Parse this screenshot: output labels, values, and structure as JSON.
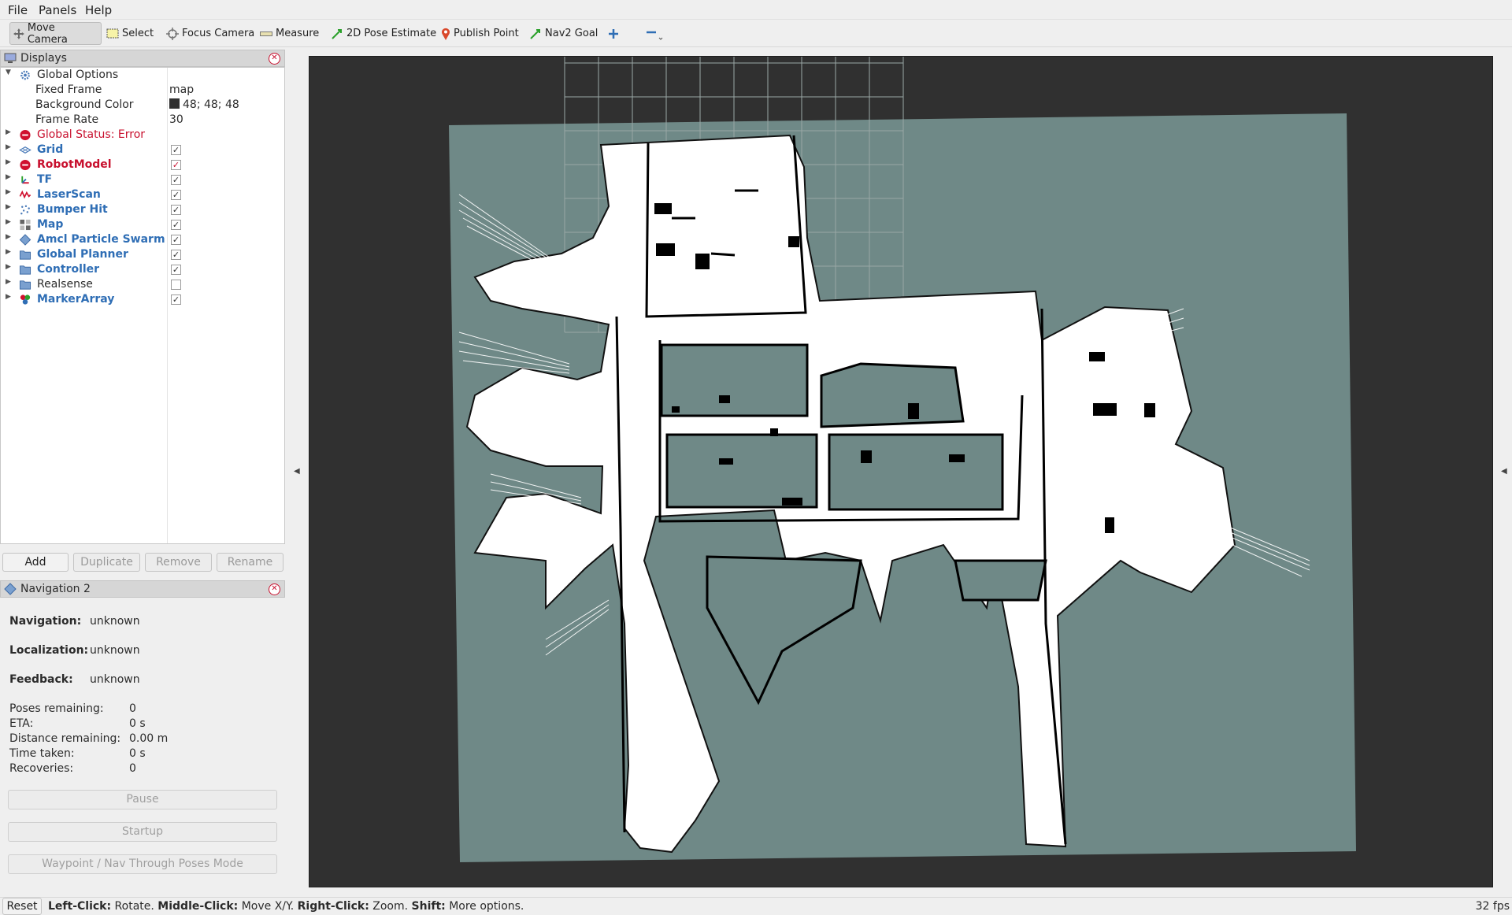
{
  "menu": {
    "file": "File",
    "panels": "Panels",
    "help": "Help"
  },
  "toolbar": {
    "move_camera": "Move Camera",
    "select": "Select",
    "focus_camera": "Focus Camera",
    "measure": "Measure",
    "pose_estimate": "2D Pose Estimate",
    "publish_point": "Publish Point",
    "nav2_goal": "Nav2 Goal"
  },
  "displays": {
    "title": "Displays",
    "global_options": "Global Options",
    "fixed_frame_label": "Fixed Frame",
    "fixed_frame_value": "map",
    "bg_color_label": "Background Color",
    "bg_color_value": "48; 48; 48",
    "frame_rate_label": "Frame Rate",
    "frame_rate_value": "30",
    "global_status": "Global Status: Error",
    "items": [
      {
        "label": "Grid",
        "checked": true
      },
      {
        "label": "RobotModel",
        "checked": true
      },
      {
        "label": "TF",
        "checked": true
      },
      {
        "label": "LaserScan",
        "checked": true
      },
      {
        "label": "Bumper Hit",
        "checked": true
      },
      {
        "label": "Map",
        "checked": true
      },
      {
        "label": "Amcl Particle Swarm",
        "checked": true
      },
      {
        "label": "Global Planner",
        "checked": true
      },
      {
        "label": "Controller",
        "checked": true
      },
      {
        "label": "Realsense",
        "checked": false
      },
      {
        "label": "MarkerArray",
        "checked": true
      }
    ],
    "buttons": {
      "add": "Add",
      "duplicate": "Duplicate",
      "remove": "Remove",
      "rename": "Rename"
    }
  },
  "nav2": {
    "title": "Navigation 2",
    "navigation_label": "Navigation:",
    "navigation_value": "unknown",
    "localization_label": "Localization:",
    "localization_value": "unknown",
    "feedback_label": "Feedback:",
    "feedback_value": "unknown",
    "poses_label": "Poses remaining:",
    "poses_value": "0",
    "eta_label": "ETA:",
    "eta_value": "0 s",
    "distance_label": "Distance remaining:",
    "distance_value": "0.00 m",
    "time_label": "Time taken:",
    "time_value": "0 s",
    "recoveries_label": "Recoveries:",
    "recoveries_value": "0",
    "pause": "Pause",
    "startup": "Startup",
    "waypoint": "Waypoint / Nav Through Poses Mode"
  },
  "status": {
    "reset": "Reset",
    "left_click": "Left-Click:",
    "left_click_desc": "Rotate.",
    "middle_click": "Middle-Click:",
    "middle_click_desc": "Move X/Y.",
    "right_click": "Right-Click:",
    "right_click_desc": "Zoom.",
    "shift": "Shift:",
    "shift_desc": "More options.",
    "fps": "32 fps"
  },
  "colors": {
    "viewport_bg": "#303030",
    "map_unknown": "#6f8987",
    "map_free": "#ffffff",
    "map_occupied": "#000000",
    "accent_blue": "#2f6eb5",
    "error_red": "#c8102e"
  }
}
